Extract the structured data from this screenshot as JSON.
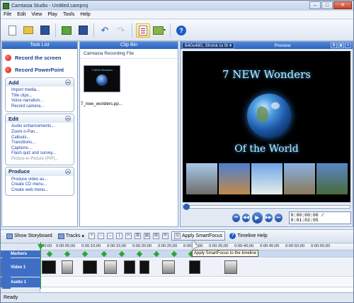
{
  "window": {
    "title": "Camtasia Studio - Untitled.camproj",
    "minimize": "–",
    "maximize": "□",
    "close": "✕"
  },
  "menu": [
    "File",
    "Edit",
    "View",
    "Play",
    "Tools",
    "Help"
  ],
  "toolbar": {
    "icons": [
      "new-project-icon",
      "open-icon",
      "save-icon",
      "import-icon",
      "save-as-icon",
      "undo-icon",
      "redo-icon",
      "task-list-icon",
      "produce-icon",
      "help-icon"
    ]
  },
  "tasklist": {
    "title": "Task List",
    "record_screen": "Record the screen",
    "record_powerpoint": "Record PowerPoint",
    "add": {
      "title": "Add",
      "items": [
        "Import media...",
        "Title clips...",
        "Voice narration...",
        "Record camera..."
      ]
    },
    "edit": {
      "title": "Edit",
      "items": [
        "Audio enhancements...",
        "Zoom-n-Pan...",
        "Callouts...",
        "Transitions...",
        "Captions...",
        "Flash quiz and survey...",
        "Picture-in-Picture (PIP)..."
      ]
    },
    "produce": {
      "title": "Produce",
      "items": [
        "Produce video as...",
        "Create CD menu...",
        "Create web menu..."
      ]
    }
  },
  "clipbin": {
    "title": "Clip Bin",
    "section": "Camtasia Recording File",
    "clip_name": "7_new_wonders.pp...",
    "thumb_text": "7 NEW Wonders"
  },
  "preview": {
    "title": "Preview",
    "size_select": "640x480, Shrink to fit ▾",
    "heading1": "7 NEW Wonders",
    "heading2": "Of the World",
    "time": "0:00:00:00 / 0:01:02:05",
    "position_fraction": 0
  },
  "timeline_toolbar": {
    "show_storyboard": "Show Storyboard",
    "tracks": "Tracks",
    "smartfocus": "Apply SmartFocus",
    "timeline_help": "Timeline Help"
  },
  "tooltip": "Apply SmartFocus to the timeline",
  "timeline": {
    "ticks": [
      "00:00",
      "0:00:05;00",
      "0:00:10;00",
      "0:00:15;00",
      "0:00:20;00",
      "0:00:25;00",
      "0:00:30;00",
      "0:00:35;00",
      "0:00:40;00",
      "0:00:45;00",
      "0:00:50;00",
      "0:00:55;00"
    ],
    "markers_label": "Markers",
    "video_label": "Video 1",
    "audio_label": "Audio 1"
  },
  "status": "Ready",
  "colors": {
    "accent": "#2d63be",
    "record": "#c81a0a",
    "marker": "#2fa23a"
  }
}
